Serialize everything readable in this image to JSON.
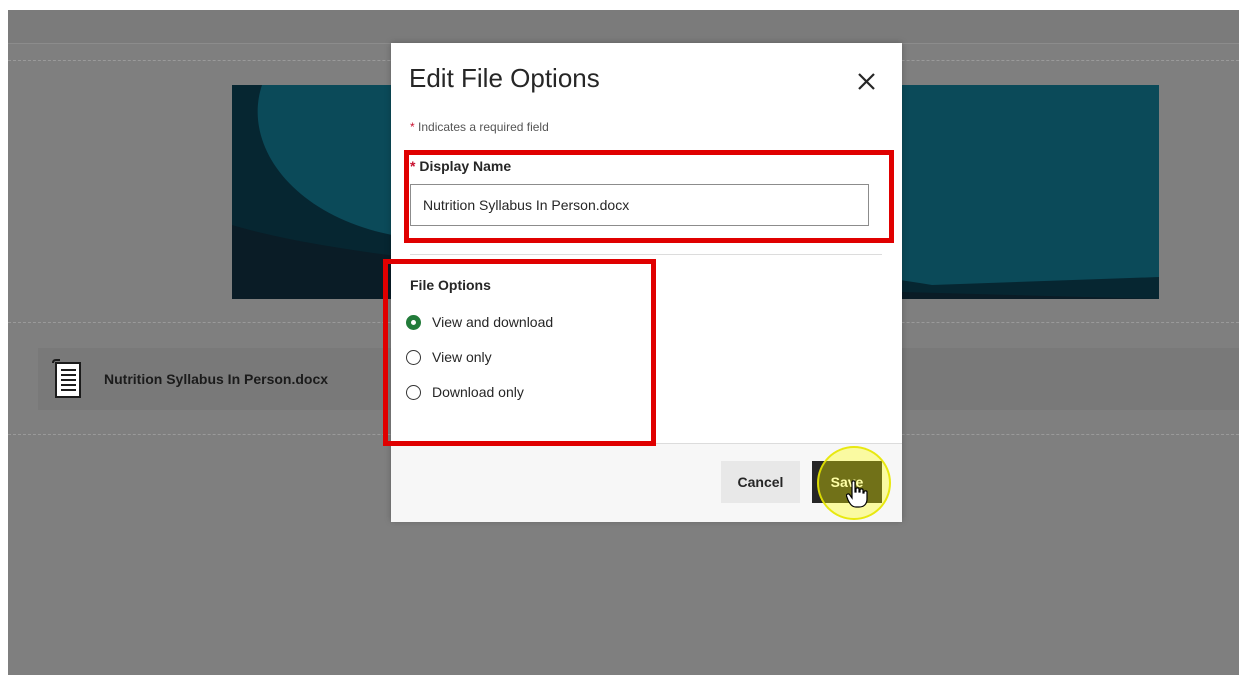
{
  "page": {
    "file_item": {
      "name": "Nutrition Syllabus In Person.docx",
      "icon": "document-icon"
    }
  },
  "modal": {
    "title": "Edit File Options",
    "close_icon": "close-icon",
    "required_star": "*",
    "required_note": "Indicates a required field",
    "display_name": {
      "label": "Display Name",
      "value": "Nutrition Syllabus In Person.docx"
    },
    "file_options": {
      "label": "File Options",
      "selected": "View and download",
      "options": [
        {
          "label": "View and download",
          "checked": true
        },
        {
          "label": "View only",
          "checked": false
        },
        {
          "label": "Download only",
          "checked": false
        }
      ]
    },
    "buttons": {
      "cancel": "Cancel",
      "save": "Save"
    }
  },
  "colors": {
    "radio_checked": "#227b3a",
    "required_star": "#c8102e",
    "annotation_box": "#e00000",
    "click_highlight": "#ffff00",
    "banner_dark": "#062631",
    "banner_teal": "#0b4a59"
  }
}
